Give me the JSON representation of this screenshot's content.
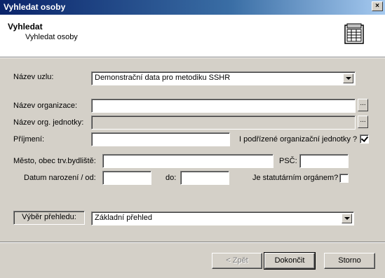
{
  "window": {
    "title": "Vyhledat osoby",
    "close_label": "×"
  },
  "header": {
    "title": "Vyhledat",
    "subtitle": "Vyhledat osoby",
    "icon": "form-icon"
  },
  "form": {
    "node_label": "Název uzlu:",
    "node_value": "Demonstrační data pro metodiku SSHR",
    "org_label": "Název organizace:",
    "org_value": "",
    "org_unit_label": "Název org. jednotky:",
    "org_unit_value": "",
    "surname_label": "Příjmení:",
    "surname_value": "",
    "sub_units_label": "I podřízené organizační jednotky ?",
    "sub_units_checked": true,
    "city_label": "Město, obec trv.bydliště:",
    "city_value": "",
    "zip_label": "PSČ:",
    "zip_value": "",
    "birth_from_label": "Datum narození / od:",
    "birth_from_value": "",
    "birth_to_label": "do:",
    "birth_to_value": "",
    "statutory_label": "Je statutárním orgánem?",
    "statutory_checked": false,
    "browse_label": "..."
  },
  "overview": {
    "label": "Výběr přehledu:",
    "value": "Základní přehled"
  },
  "buttons": {
    "back": "< Zpět",
    "finish": "Dokončit",
    "cancel": "Storno"
  }
}
